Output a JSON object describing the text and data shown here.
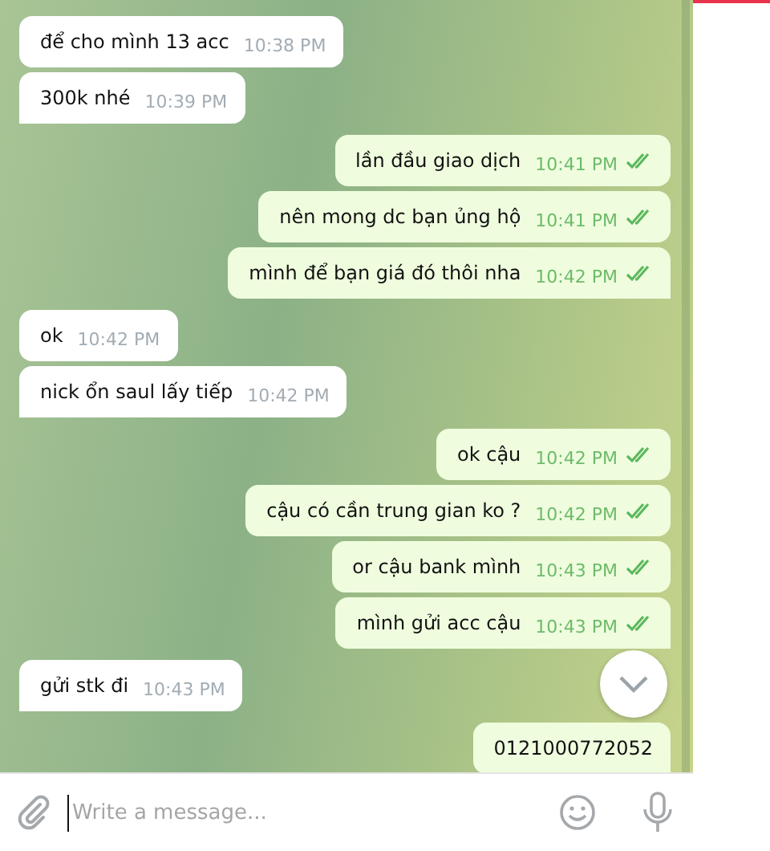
{
  "messages": [
    {
      "kind": "incoming",
      "text": "để cho mình 13 acc",
      "time": "10:38 PM"
    },
    {
      "kind": "incoming",
      "text": "300k nhé",
      "time": "10:39 PM"
    },
    {
      "kind": "outgoing",
      "text": "lần đầu giao dịch",
      "time": "10:41 PM",
      "read": true
    },
    {
      "kind": "outgoing",
      "text": "nên mong dc bạn ủng hộ",
      "time": "10:41 PM",
      "read": true
    },
    {
      "kind": "outgoing",
      "text": "mình để bạn giá đó thôi nha",
      "time": "10:42 PM",
      "read": true
    },
    {
      "kind": "incoming",
      "text": "ok",
      "time": "10:42 PM"
    },
    {
      "kind": "incoming",
      "text": "nick ổn saul lấy tiếp",
      "time": "10:42 PM"
    },
    {
      "kind": "outgoing",
      "text": "ok cậu",
      "time": "10:42 PM",
      "read": true
    },
    {
      "kind": "outgoing",
      "text": "cậu có cần trung gian ko ?",
      "time": "10:42 PM",
      "read": true
    },
    {
      "kind": "outgoing",
      "text": "or cậu bank mình",
      "time": "10:43 PM",
      "read": true
    },
    {
      "kind": "outgoing",
      "text": "mình gửi acc cậu",
      "time": "10:43 PM",
      "read": true
    },
    {
      "kind": "incoming",
      "text": "gửi stk đi",
      "time": "10:43 PM"
    },
    {
      "kind": "outgoing",
      "text": "0121000772052"
    }
  ],
  "composer": {
    "placeholder": "Write a message..."
  }
}
